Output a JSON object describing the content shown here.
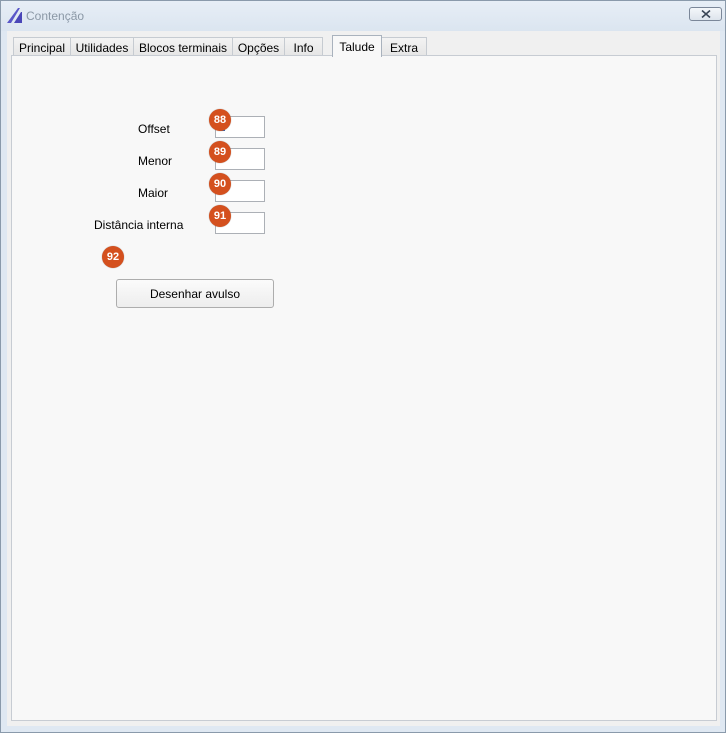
{
  "window": {
    "title": "Contenção",
    "close_icon": "close-icon",
    "app_icon": "app-logo-icon"
  },
  "tabs": [
    {
      "label": "Principal"
    },
    {
      "label": "Utilidades"
    },
    {
      "label": "Blocos terminais"
    },
    {
      "label": "Opções"
    },
    {
      "label": "Info"
    },
    {
      "label": "Talude"
    },
    {
      "label": "Extra"
    }
  ],
  "active_tab": "Talude",
  "form": {
    "offset_label": "Offset",
    "offset_value": "",
    "menor_label": "Menor",
    "menor_value": "",
    "maior_label": "Maior",
    "maior_value": "",
    "distancia_label": "Distância interna",
    "distancia_value": "",
    "draw_button_label": "Desenhar avulso"
  },
  "badges": {
    "offset": "88",
    "menor": "89",
    "maior": "90",
    "distancia": "91",
    "draw_button": "92"
  },
  "colors": {
    "badge": "#d4501e",
    "titlebar": "#dfe8f2",
    "panel": "#f8f8f8"
  }
}
